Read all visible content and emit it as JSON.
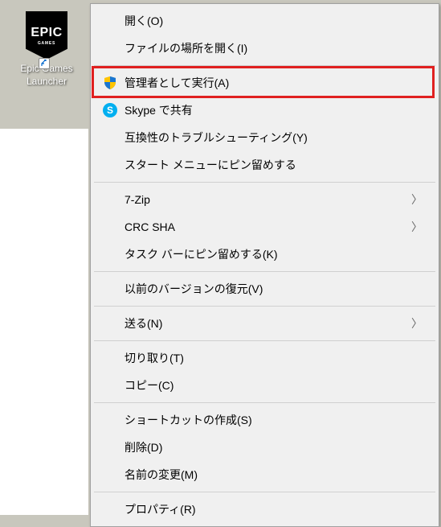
{
  "desktop": {
    "icon_label": "Epic Games Launcher",
    "logo_main": "EPIC",
    "logo_sub": "GAMES"
  },
  "menu": {
    "items": [
      {
        "label": "開く(O)",
        "icon": null,
        "arrow": false,
        "highlighted": false
      },
      {
        "label": "ファイルの場所を開く(I)",
        "icon": null,
        "arrow": false,
        "highlighted": false
      },
      {
        "sep": true
      },
      {
        "label": "管理者として実行(A)",
        "icon": "shield",
        "arrow": false,
        "highlighted": true
      },
      {
        "label": "Skype で共有",
        "icon": "skype",
        "arrow": false,
        "highlighted": false
      },
      {
        "label": "互換性のトラブルシューティング(Y)",
        "icon": null,
        "arrow": false,
        "highlighted": false
      },
      {
        "label": "スタート メニューにピン留めする",
        "icon": null,
        "arrow": false,
        "highlighted": false
      },
      {
        "sep": true
      },
      {
        "label": "7-Zip",
        "icon": null,
        "arrow": true,
        "highlighted": false
      },
      {
        "label": "CRC SHA",
        "icon": null,
        "arrow": true,
        "highlighted": false
      },
      {
        "label": "タスク バーにピン留めする(K)",
        "icon": null,
        "arrow": false,
        "highlighted": false
      },
      {
        "sep": true
      },
      {
        "label": "以前のバージョンの復元(V)",
        "icon": null,
        "arrow": false,
        "highlighted": false
      },
      {
        "sep": true
      },
      {
        "label": "送る(N)",
        "icon": null,
        "arrow": true,
        "highlighted": false
      },
      {
        "sep": true
      },
      {
        "label": "切り取り(T)",
        "icon": null,
        "arrow": false,
        "highlighted": false
      },
      {
        "label": "コピー(C)",
        "icon": null,
        "arrow": false,
        "highlighted": false
      },
      {
        "sep": true
      },
      {
        "label": "ショートカットの作成(S)",
        "icon": null,
        "arrow": false,
        "highlighted": false
      },
      {
        "label": "削除(D)",
        "icon": null,
        "arrow": false,
        "highlighted": false
      },
      {
        "label": "名前の変更(M)",
        "icon": null,
        "arrow": false,
        "highlighted": false
      },
      {
        "sep": true
      },
      {
        "label": "プロパティ(R)",
        "icon": null,
        "arrow": false,
        "highlighted": false
      }
    ]
  }
}
